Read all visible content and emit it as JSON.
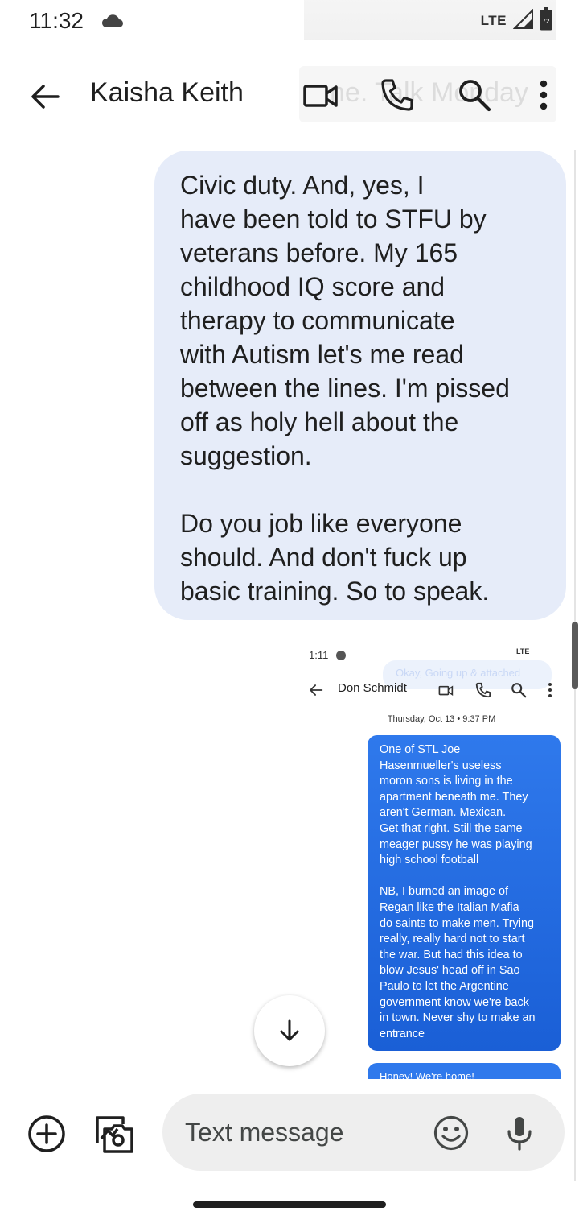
{
  "status_bar": {
    "time": "11:32",
    "network": "LTE",
    "battery_level": "72"
  },
  "header": {
    "contact_name": "Kaisha Keith",
    "ghost_text": "ne. Talk Monday",
    "icons": [
      "back-arrow-icon",
      "video-call-icon",
      "phone-icon",
      "search-icon",
      "more-vert-icon"
    ]
  },
  "conversation": {
    "message_text": "Civic duty. And, yes, I\nhave been told to STFU by\nveterans before. My 165\nchildhood IQ score and\ntherapy to communicate\nwith Autism let's me read\nbetween the lines. I'm pissed\noff as holy hell about the\nsuggestion.\n\nDo you job like everyone\nshould. And don't fuck up\nbasic training. So to speak."
  },
  "attachment": {
    "status_time": "1:11",
    "status_right": "LTE",
    "ghost_text": "Okay, Going up & attached",
    "contact_name": "Don Schmidt",
    "date_header": "Thursday, Oct 13 • 9:37 PM",
    "message_text": "One of STL Joe\nHasenmueller's useless\nmoron sons is living in the\napartment beneath me. They\naren't German. Mexican.\nGet that right. Still the same\nmeager pussy he was playing\nhigh school football\n\nNB, I burned an image of\nRegan like the Italian Mafia\ndo saints to make men. Trying\nreally, really hard not to start\nthe war. But had this idea to\nblow Jesus' head off in Sao\nPaulo to let the Argentine\ngovernment know we're back\nin town. Never shy to make an\nentrance",
    "next_message_text": "Honey! We're home!"
  },
  "compose": {
    "placeholder": "Text message"
  },
  "colors": {
    "outgoing_bubble": "#e6ecf9",
    "attachment_bubble": "#1a5fd6",
    "compose_background": "#eeeeee"
  }
}
